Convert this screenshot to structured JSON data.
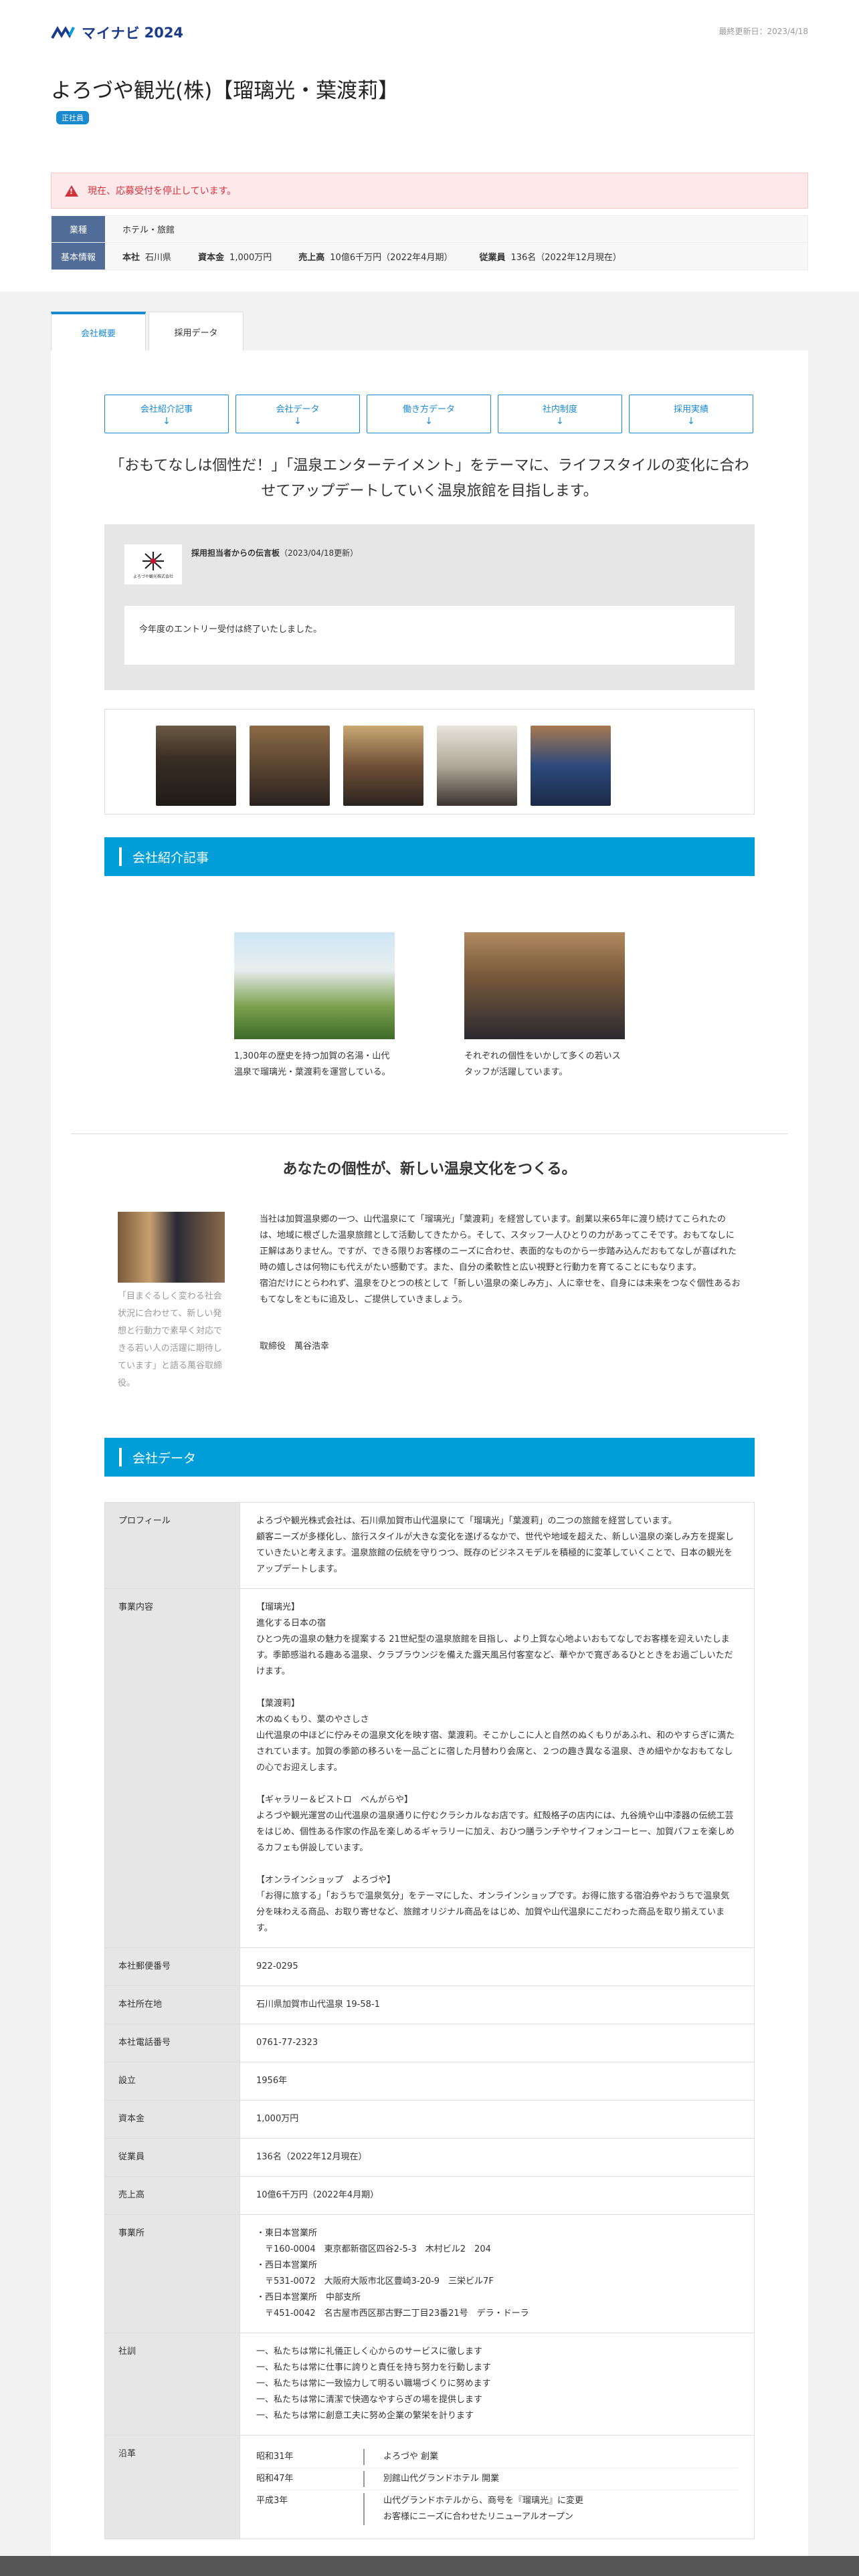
{
  "header": {
    "brand": "マイナビ",
    "year": "2024",
    "updated": "最終更新日：2023/4/18"
  },
  "company": {
    "name": "よろづや観光(株)【瑠璃光・葉渡莉】",
    "badge": "正社員"
  },
  "alert": "現在、応募受付を停止しています。",
  "basic_info": {
    "industry_label": "業種",
    "industry_value": "ホテル・旅館",
    "basic_label": "基本情報",
    "hq_label": "本社",
    "hq_value": "石川県",
    "capital_label": "資本金",
    "capital_value": "1,000万円",
    "sales_label": "売上高",
    "sales_value": "10億6千万円（2022年4月期）",
    "employees_label": "従業員",
    "employees_value": "136名（2022年12月現在）"
  },
  "tabs": [
    "会社概要",
    "採用データ"
  ],
  "nav_buttons": [
    "会社紹介記事",
    "会社データ",
    "働き方データ",
    "社内制度",
    "採用実績"
  ],
  "nav_arrow": "↓",
  "catch": "「おもてなしは個性だ！」「温泉エンターテイメント」をテーマに、ライフスタイルの変化に合わせてアップデートしていく温泉旅館を目指します。",
  "message": {
    "logo_caption": "よろづや観光株式会社",
    "title": "採用担当者からの伝言板",
    "date": "（2023/04/18更新）",
    "body": "今年度のエントリー受付は終了いたしました。"
  },
  "sections": {
    "intro": "会社紹介記事",
    "data": "会社データ"
  },
  "articles": [
    {
      "caption": "1,300年の歴史を持つ加賀の名湯・山代温泉で瑠璃光・葉渡莉を運営している。"
    },
    {
      "caption": "それぞれの個性をいかして多くの若いスタッフが活躍しています。"
    }
  ],
  "story": {
    "heading": "あなたの個性が、新しい温泉文化をつくる。",
    "photo_caption": "「目まぐるしく変わる社会状況に合わせて、新しい発想と行動力で素早く対応できる若い人の活躍に期待しています」と語る萬谷取締役。",
    "text": "当社は加賀温泉郷の一つ、山代温泉にて「瑠璃光」「葉渡莉」を経営しています。創業以来65年に渡り続けてこられたのは、地域に根ざした温泉旅館として活動してきたから。そして、スタッフ一人ひとりの力があってこそです。おもてなしに正解はありません。ですが、できる限りお客様のニーズに合わせ、表面的なものから一歩踏み込んだおもてなしが喜ばれた時の嬉しさは何物にも代えがたい感動です。また、自分の柔軟性と広い視野と行動力を育てることにもなります。\n宿泊だけにとらわれず、温泉をひとつの核として「新しい温泉の楽しみ方」、人に幸せを、自身には未来をつなぐ個性あるおもてなしをともに追及し、ご提供していきましょう。",
    "signature": "取締役　萬谷浩幸"
  },
  "company_data": [
    {
      "key": "プロフィール",
      "value": "よろづや観光株式会社は、石川県加賀市山代温泉にて「瑠璃光」「葉渡莉」の二つの旅館を経営しています。\n顧客ニーズが多様化し、旅行スタイルが大きな変化を遂げるなかで、世代や地域を超えた、新しい温泉の楽しみ方を提案していきたいと考えます。温泉旅館の伝統を守りつつ、既存のビジネスモデルを積極的に変革していくことで、日本の観光をアップデートします。"
    },
    {
      "key": "事業内容",
      "value": "【瑠璃光】\n進化する日本の宿\nひとつ先の温泉の魅力を提案する 21世紀型の温泉旅館を目指し、より上質な心地よいおもてなしでお客様を迎えいたします。季節感溢れる趣ある温泉、クラブラウンジを備えた露天風呂付客室など、華やかで寛ぎあるひとときをお過ごしいただけます。\n\n【葉渡莉】\n木のぬくもり、葉のやさしさ\n山代温泉の中ほどに佇みその温泉文化を映す宿、葉渡莉。そこかしこに人と自然のぬくもりがあふれ、和のやすらぎに満たされています。加賀の季節の移ろいを一品ごとに宿した月替わり会席と、２つの趣き異なる温泉、きめ細やかなおもてなしの心でお迎えします。\n\n【ギャラリー＆ビストロ　べんがらや】\nよろづや観光運営の山代温泉の温泉通りに佇むクラシカルなお店です。紅殻格子の店内には、九谷焼や山中漆器の伝統工芸をはじめ、個性ある作家の作品を楽しめるギャラリーに加え、おひつ膳ランチやサイフォンコーヒー、加賀パフェを楽しめるカフェも併設しています。\n\n【オンラインショップ　よろづや】\n「お得に旅する」「おうちで温泉気分」をテーマにした、オンラインショップです。お得に旅する宿泊券やおうちで温泉気分を味わえる商品、お取り寄せなど、旅館オリジナル商品をはじめ、加賀や山代温泉にこだわった商品を取り揃えています。"
    },
    {
      "key": "本社郵便番号",
      "value": "922-0295"
    },
    {
      "key": "本社所在地",
      "value": "石川県加賀市山代温泉 19-58-1"
    },
    {
      "key": "本社電話番号",
      "value": "0761-77-2323"
    },
    {
      "key": "設立",
      "value": "1956年"
    },
    {
      "key": "資本金",
      "value": "1,000万円"
    },
    {
      "key": "従業員",
      "value": "136名（2022年12月現在）"
    },
    {
      "key": "売上高",
      "value": "10億6千万円（2022年4月期）"
    },
    {
      "key": "事業所",
      "value": "・東日本営業所\n　〒160-0004　東京都新宿区四谷2-5-3　木村ビル2　204\n・西日本営業所\n　〒531-0072　大阪府大阪市北区豊崎3-20-9　三栄ビル7F\n・西日本営業所　中部支所\n　〒451-0042　名古屋市西区那古野二丁目23番21号　デラ・ドーラ"
    },
    {
      "key": "社訓",
      "value": "一、私たちは常に礼儀正しく心からのサービスに徹します\n一、私たちは常に仕事に誇りと責任を持ち努力を行動します\n一、私たちは常に一致協力して明るい職場づくりに努めます\n一、私たちは常に清潔で快適なやすらぎの場を提供します\n一、私たちは常に創意工夫に努め企業の繁栄を計ります"
    }
  ],
  "history_key": "沿革",
  "history": [
    {
      "year": "昭和31年",
      "event": "よろづや 創業"
    },
    {
      "year": "昭和47年",
      "event": "別館山代グランドホテル 開業"
    },
    {
      "year": "平成3年",
      "event": "山代グランドホテルから、商号を『瑠璃光』に変更\nお客様にニーズに合わせたリニューアルオープン"
    }
  ],
  "colors": {
    "accent": "#009ed8",
    "brand": "#1a3a8c",
    "alert": "#d2323c"
  }
}
